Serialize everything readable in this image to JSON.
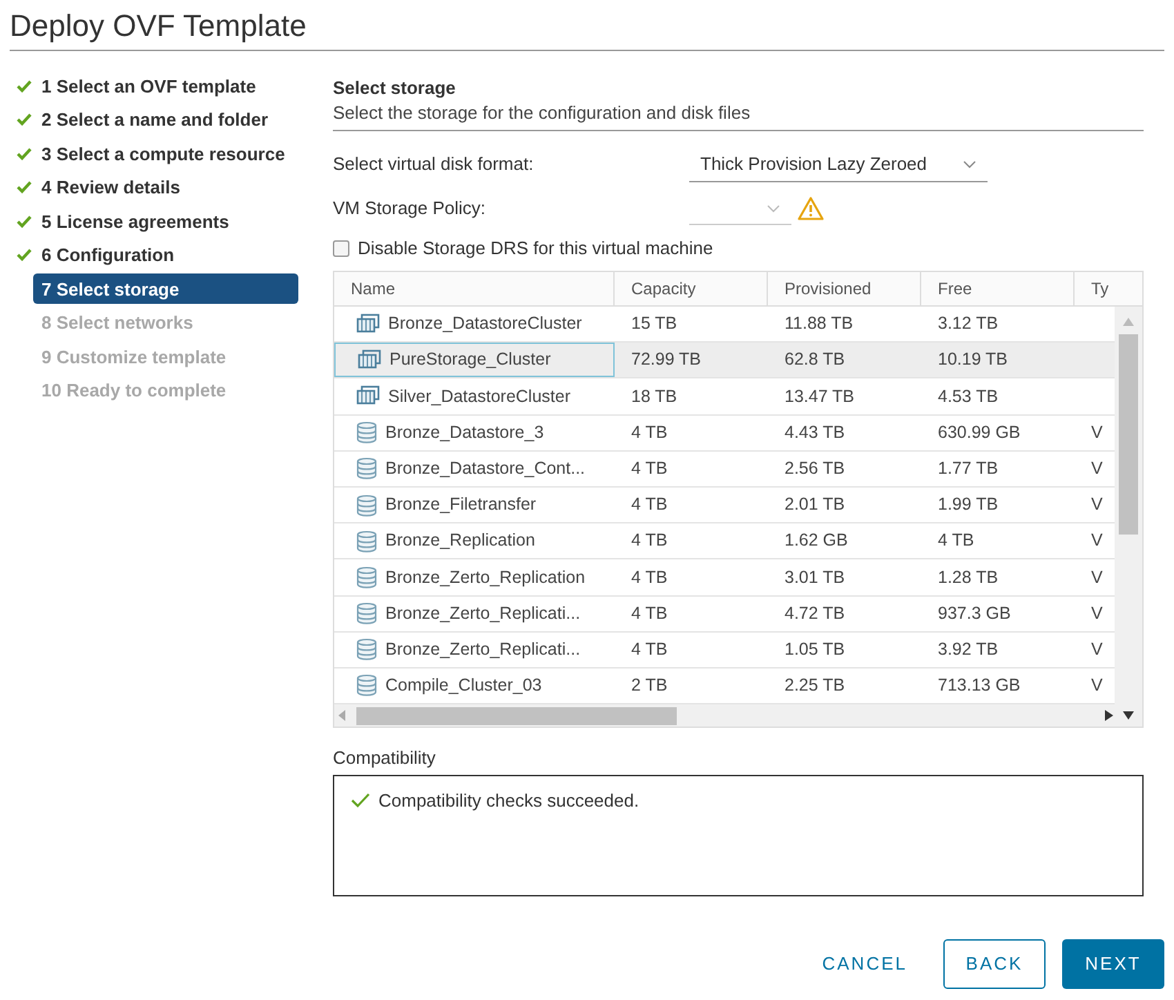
{
  "window": {
    "title": "Deploy OVF Template"
  },
  "steps": [
    {
      "label": "1 Select an OVF template",
      "completed": true,
      "selected": false
    },
    {
      "label": "2 Select a name and folder",
      "completed": true,
      "selected": false
    },
    {
      "label": "3 Select a compute resource",
      "completed": true,
      "selected": false
    },
    {
      "label": "4 Review details",
      "completed": true,
      "selected": false
    },
    {
      "label": "5 License agreements",
      "completed": true,
      "selected": false
    },
    {
      "label": "6 Configuration",
      "completed": true,
      "selected": false
    },
    {
      "label": "7 Select storage",
      "completed": false,
      "selected": true
    },
    {
      "label": "8 Select networks",
      "completed": false,
      "selected": false
    },
    {
      "label": "9 Customize template",
      "completed": false,
      "selected": false
    },
    {
      "label": "10 Ready to complete",
      "completed": false,
      "selected": false
    }
  ],
  "section": {
    "title": "Select storage",
    "subtitle": "Select the storage for the configuration and disk files"
  },
  "disk_format": {
    "label": "Select virtual disk format:",
    "value": "Thick Provision Lazy Zeroed"
  },
  "storage_policy": {
    "label": "VM Storage Policy:",
    "warning": true
  },
  "disable_drs": {
    "label": "Disable Storage DRS for this virtual machine",
    "checked": false
  },
  "table": {
    "columns": [
      "Name",
      "Capacity",
      "Provisioned",
      "Free",
      "Ty"
    ],
    "rows": [
      {
        "kind": "cluster",
        "selected": false,
        "cells": [
          "Bronze_DatastoreCluster",
          "15 TB",
          "11.88 TB",
          "3.12 TB"
        ]
      },
      {
        "kind": "cluster",
        "selected": true,
        "cells": [
          "PureStorage_Cluster",
          "72.99 TB",
          "62.8 TB",
          "10.19 TB"
        ]
      },
      {
        "kind": "cluster",
        "selected": false,
        "cells": [
          "Silver_DatastoreCluster",
          "18 TB",
          "13.47 TB",
          "4.53 TB"
        ]
      },
      {
        "kind": "datastore",
        "selected": false,
        "cells": [
          "Bronze_Datastore_3",
          "4 TB",
          "4.43 TB",
          "630.99 GB",
          "V"
        ]
      },
      {
        "kind": "datastore",
        "selected": false,
        "cells": [
          "Bronze_Datastore_Cont...",
          "4 TB",
          "2.56 TB",
          "1.77 TB",
          "V"
        ]
      },
      {
        "kind": "datastore",
        "selected": false,
        "cells": [
          "Bronze_Filetransfer",
          "4 TB",
          "2.01 TB",
          "1.99 TB",
          "V"
        ]
      },
      {
        "kind": "datastore",
        "selected": false,
        "cells": [
          "Bronze_Replication",
          "4 TB",
          "1.62 GB",
          "4 TB",
          "V"
        ]
      },
      {
        "kind": "datastore",
        "selected": false,
        "cells": [
          "Bronze_Zerto_Replication",
          "4 TB",
          "3.01 TB",
          "1.28 TB",
          "V"
        ]
      },
      {
        "kind": "datastore",
        "selected": false,
        "cells": [
          "Bronze_Zerto_Replicati...",
          "4 TB",
          "4.72 TB",
          "937.3 GB",
          "V"
        ]
      },
      {
        "kind": "datastore",
        "selected": false,
        "cells": [
          "Bronze_Zerto_Replicati...",
          "4 TB",
          "1.05 TB",
          "3.92 TB",
          "V"
        ]
      },
      {
        "kind": "datastore",
        "selected": false,
        "cells": [
          "Compile_Cluster_03",
          "2 TB",
          "2.25 TB",
          "713.13 GB",
          "V"
        ]
      }
    ]
  },
  "compatibility": {
    "label": "Compatibility",
    "message": "Compatibility checks succeeded.",
    "ok": true
  },
  "buttons": [
    {
      "label": "CANCEL",
      "kind": "flat"
    },
    {
      "label": "BACK",
      "kind": "outline"
    },
    {
      "label": "NEXT",
      "kind": "primary"
    }
  ]
}
